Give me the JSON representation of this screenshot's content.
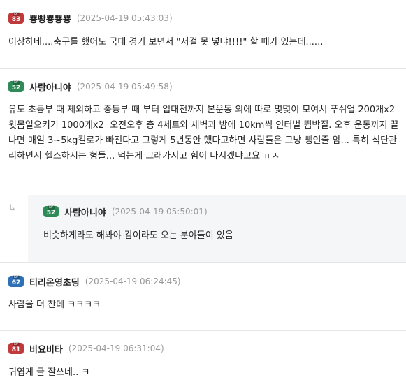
{
  "comments": [
    {
      "nickname": "뿅빵뿅뿅뿅",
      "timestamp": "(2025-04-19 05:43:03)",
      "level": "83",
      "badge_color": "#c0393b",
      "text": "이상하네....축구를 했어도 국대 경기 보면서 \"저걸 못 넣냐!!!!\" 할 때가 있는데......"
    },
    {
      "nickname": "사람아니야",
      "timestamp": "(2025-04-19 05:49:58)",
      "level": "52",
      "badge_color": "#2e8b57",
      "text": "유도 초등부 때 제외하고 중등부 때 부터 입대전까지 본운동 외에 따로 몇몇이 모여서 푸쉬업 200개x2 윗몸일으키기 1000개x2  오전오후 총 4세트와 새벽과 밤에 10km씩 인터벌 뜀박질. 오후 운동까지 끝나면 매일 3~5kg킬로가 빠진다고 그렇게 5년동안 했다고하면 사람들은 그냥 뺑인줄 암... 특히 식단관리하면서 헬스하시는 형들... 먹는게 그래가지고 힘이 나시겠냐고요 ㅠㅅ"
    },
    {
      "nickname": "사람아니야",
      "timestamp": "(2025-04-19 05:50:01)",
      "level": "52",
      "badge_color": "#2e8b57",
      "text": "비슷하게라도 해봐야 감이라도 오는 분야들이 있음",
      "is_reply": true,
      "reply_icon": "↳"
    },
    {
      "nickname": "티리온영초딩",
      "timestamp": "(2025-04-19 06:24:45)",
      "level": "62",
      "badge_color": "#2f6fb5",
      "text": "사람을 더 찬데 ㅋㅋㅋㅋ"
    },
    {
      "nickname": "비요비타",
      "timestamp": "(2025-04-19 06:31:04)",
      "level": "81",
      "badge_color": "#c0393b",
      "text": "귀엽게 글 잘쓰네.. ㅋ"
    }
  ],
  "badge_lv_label": "LV"
}
